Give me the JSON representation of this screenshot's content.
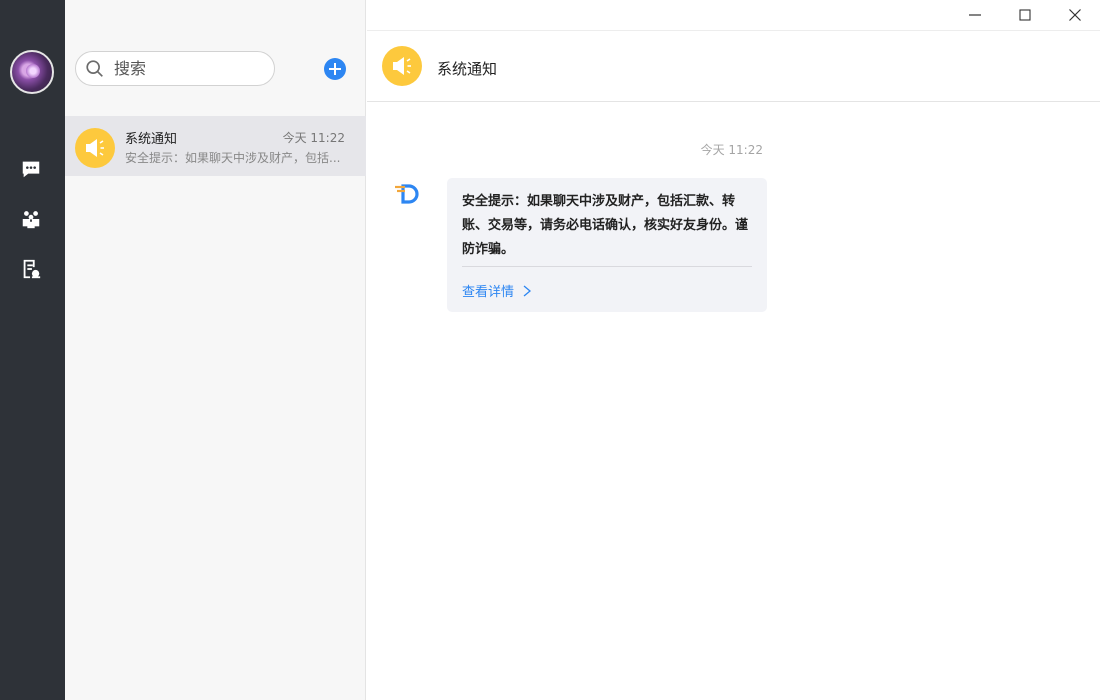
{
  "window": {
    "controls": [
      "minimize",
      "maximize",
      "close"
    ]
  },
  "rail": {
    "items": [
      {
        "icon": "chat-bubble-icon"
      },
      {
        "icon": "contacts-icon"
      },
      {
        "icon": "notes-icon"
      }
    ]
  },
  "search": {
    "placeholder": "搜索"
  },
  "conversations": [
    {
      "name": "系统通知",
      "time": "今天 11:22",
      "preview": "安全提示：如果聊天中涉及财产，包括..."
    }
  ],
  "chat": {
    "title": "系统通知",
    "timestamp": "今天 11:22",
    "message": {
      "text": "安全提示：如果聊天中涉及财产，包括汇款、转账、交易等，请务必电话确认，核实好友身份。谨防诈骗。",
      "link_label": "查看详情"
    }
  },
  "colors": {
    "rail_bg": "#2e3238",
    "accent_blue": "#2d86f2",
    "notice_yellow": "#fdc93d",
    "selected_row": "#e6e6ea",
    "bubble_bg": "#f2f3f7"
  }
}
